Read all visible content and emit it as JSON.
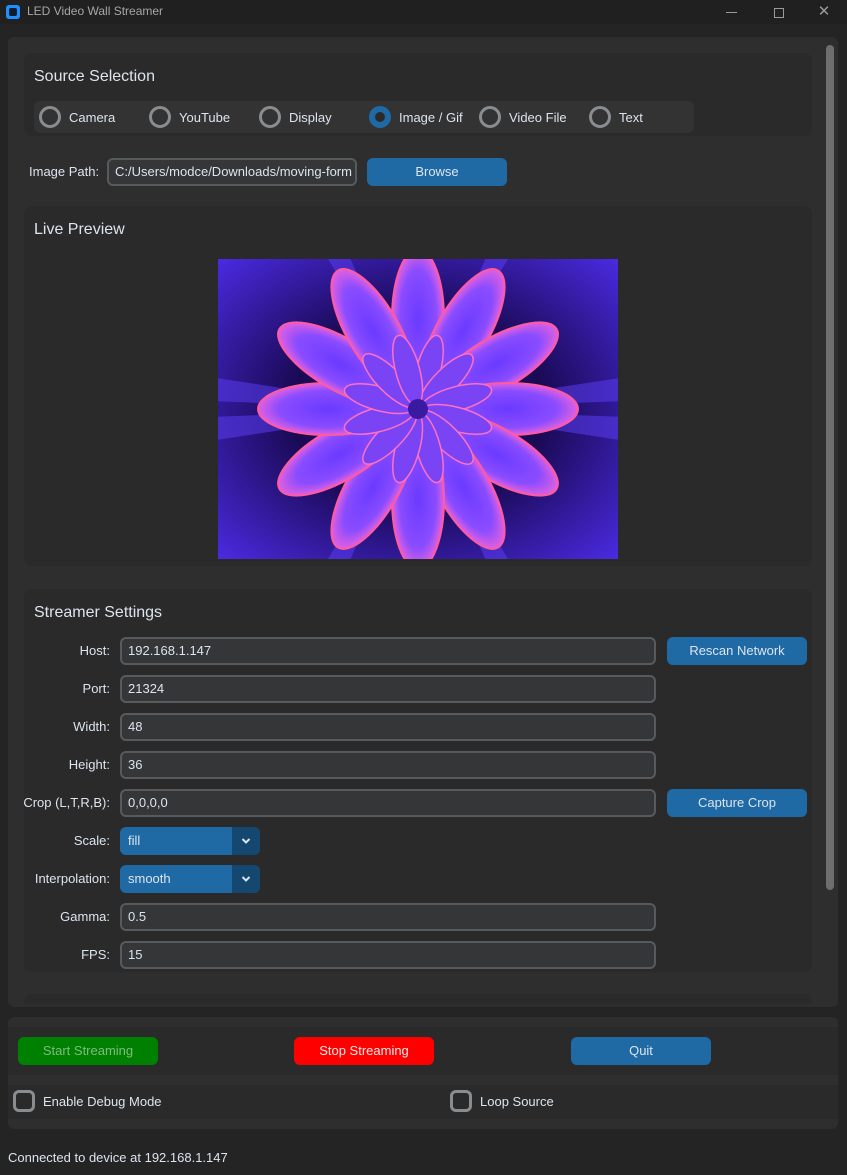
{
  "window": {
    "title": "LED Video Wall Streamer",
    "controls": {
      "minimize": "minimize",
      "maximize": "maximize",
      "close": "✕"
    }
  },
  "source_selection": {
    "title": "Source Selection",
    "options": [
      {
        "label": "Camera",
        "checked": false
      },
      {
        "label": "YouTube",
        "checked": false
      },
      {
        "label": "Display",
        "checked": false
      },
      {
        "label": "Image / Gif",
        "checked": true
      },
      {
        "label": "Video File",
        "checked": false
      },
      {
        "label": "Text",
        "checked": false
      }
    ]
  },
  "image_path": {
    "label": "Image Path:",
    "value": "C:/Users/modce/Downloads/moving-form",
    "browse_label": "Browse"
  },
  "preview": {
    "title": "Live Preview",
    "image_description": "purple fractal flower"
  },
  "settings": {
    "title": "Streamer Settings",
    "host": {
      "label": "Host:",
      "value": "192.168.1.147"
    },
    "port": {
      "label": "Port:",
      "value": "21324"
    },
    "width": {
      "label": "Width:",
      "value": "48"
    },
    "height": {
      "label": "Height:",
      "value": "36"
    },
    "crop": {
      "label": "Crop (L,T,R,B):",
      "value": "0,0,0,0"
    },
    "scale": {
      "label": "Scale:",
      "value": "fill"
    },
    "interpolation": {
      "label": "Interpolation:",
      "value": "smooth"
    },
    "gamma": {
      "label": "Gamma:",
      "value": "0.5"
    },
    "fps": {
      "label": "FPS:",
      "value": "15"
    },
    "rescan_label": "Rescan Network",
    "capture_crop_label": "Capture Crop",
    "dropdown_arrow": "⌄"
  },
  "actions": {
    "start_label": "Start Streaming",
    "stop_label": "Stop Streaming",
    "quit_label": "Quit",
    "start_color": "#008000",
    "stop_color": "#ff0000",
    "accent_color": "#1f6aa5"
  },
  "options": {
    "debug_label": "Enable Debug Mode",
    "debug_checked": false,
    "loop_label": "Loop Source",
    "loop_checked": false
  },
  "status": "Connected to device at 192.168.1.147"
}
